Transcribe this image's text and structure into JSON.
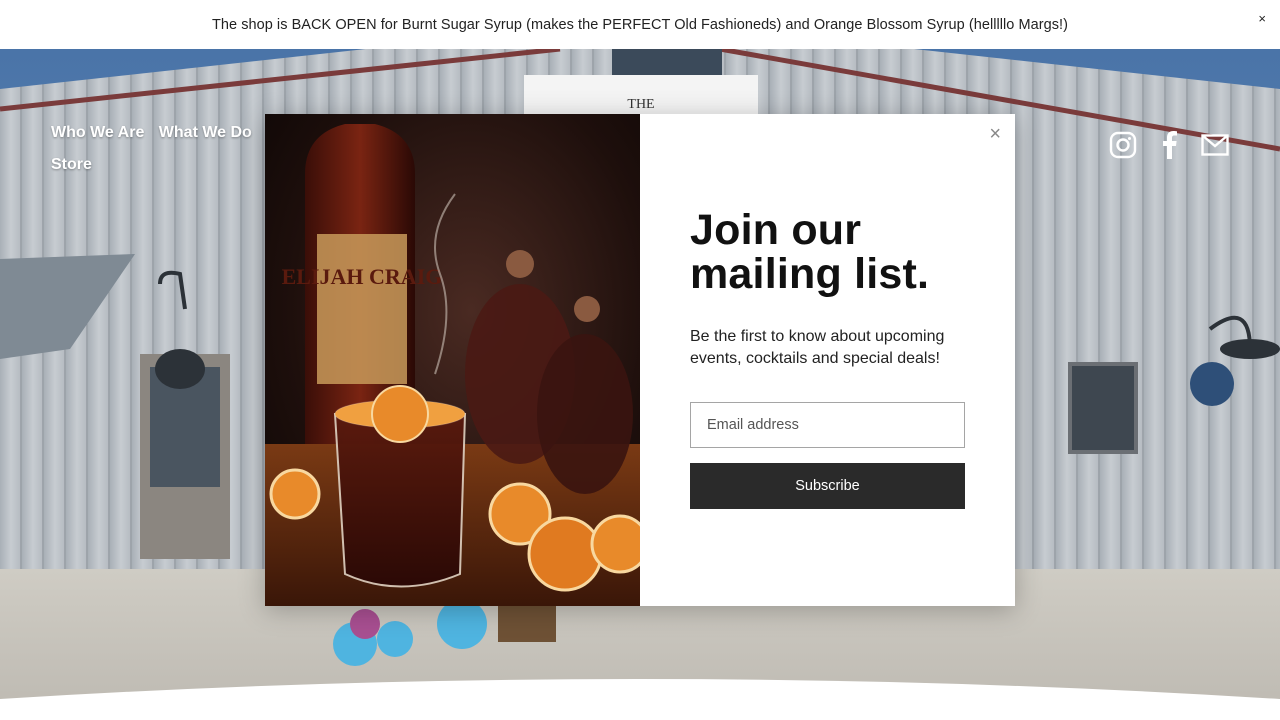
{
  "announcement": {
    "text": "The shop is BACK OPEN for Burnt Sugar Syrup (makes the PERFECT Old Fashioneds) and Orange Blossom Syrup (helllllo Margs!)",
    "close_label": "×"
  },
  "nav": {
    "items": [
      {
        "label": "Who We Are"
      },
      {
        "label": "What We Do"
      },
      {
        "label": "Store"
      }
    ]
  },
  "socials": {
    "icons": [
      "instagram-icon",
      "facebook-icon",
      "email-icon"
    ]
  },
  "hero": {
    "sign_text": "THE"
  },
  "modal": {
    "close_label": "×",
    "title": "Join our mailing list.",
    "description": "Be the first to know about upcoming events, cocktails and special deals!",
    "email_placeholder": "Email address",
    "subscribe_label": "Subscribe",
    "image": {
      "bottle_label": "ELIJAH CRAIG"
    }
  }
}
